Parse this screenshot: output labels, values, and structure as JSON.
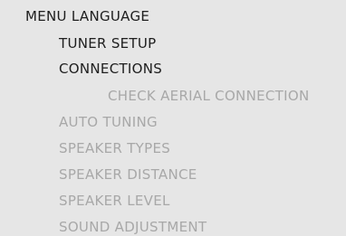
{
  "menu": {
    "title": "MENU LANGUAGE",
    "items": [
      {
        "label": "TUNER SETUP",
        "state": "active"
      },
      {
        "label": "CONNECTIONS",
        "state": "active"
      },
      {
        "label": "CHECK AERIAL CONNECTION",
        "state": "dim"
      },
      {
        "label": "AUTO TUNING",
        "state": "dim"
      },
      {
        "label": "SPEAKER TYPES",
        "state": "dim"
      },
      {
        "label": "SPEAKER DISTANCE",
        "state": "dim"
      },
      {
        "label": "SPEAKER LEVEL",
        "state": "dim"
      },
      {
        "label": "SOUND ADJUSTMENT",
        "state": "dim"
      }
    ]
  },
  "colors": {
    "background": "#e6e6e6",
    "active_text": "#1e1e1e",
    "dim_text": "#a8a8a8"
  }
}
